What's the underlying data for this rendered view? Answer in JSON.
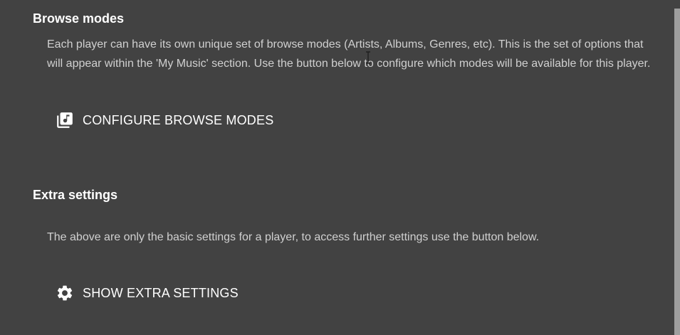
{
  "browse_modes": {
    "title": "Browse modes",
    "description": "Each player can have its own unique set of browse modes (Artists, Albums, Genres, etc). This is the set of options that will appear within the 'My Music' section. Use the button below to configure which modes will be available for this player.",
    "button_label": "CONFIGURE BROWSE MODES",
    "button_icon": "library-music-icon"
  },
  "extra_settings": {
    "title": "Extra settings",
    "description": "The above are only the basic settings for a player, to access further settings use the button below.",
    "button_label": "SHOW EXTRA SETTINGS",
    "button_icon": "gear-icon"
  },
  "colors": {
    "background": "#424242",
    "title_text": "#ffffff",
    "body_text": "#d0d0d0",
    "scrollbar_thumb": "#9e9e9e"
  }
}
